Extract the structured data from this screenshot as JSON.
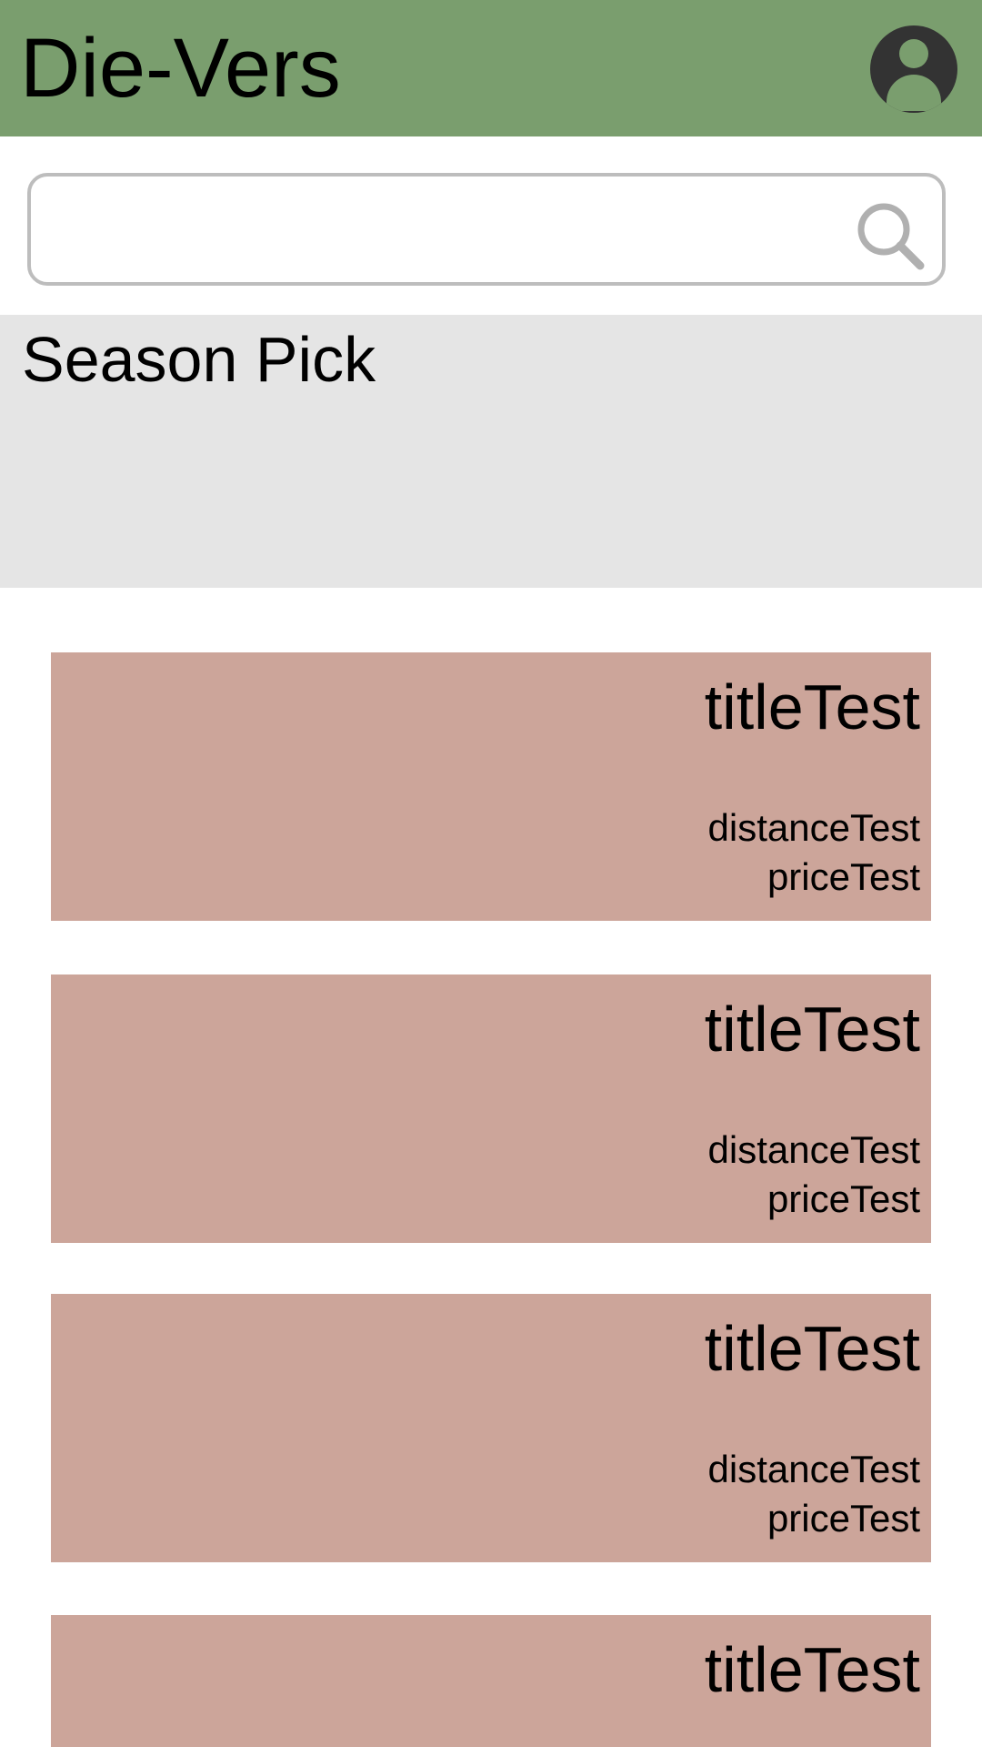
{
  "header": {
    "title": "Die-Vers",
    "avatar_icon": "account-circle-icon",
    "background_color": "#7a9e6e"
  },
  "search": {
    "value": "",
    "placeholder": "",
    "icon": "search-icon"
  },
  "season_pick": {
    "title": "Season Pick"
  },
  "cards": [
    {
      "title": "titleTest",
      "distance": "distanceTest",
      "price": "priceTest"
    },
    {
      "title": "titleTest",
      "distance": "distanceTest",
      "price": "priceTest"
    },
    {
      "title": "titleTest",
      "distance": "distanceTest",
      "price": "priceTest"
    },
    {
      "title": "titleTest"
    }
  ],
  "colors": {
    "card_background": "#cca59a",
    "season_background": "#e5e5e5"
  }
}
